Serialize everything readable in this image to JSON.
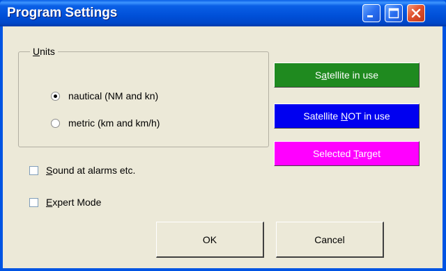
{
  "window": {
    "title": "Program Settings",
    "controls": [
      "minimize-icon",
      "maximize-icon",
      "close-icon"
    ]
  },
  "units_group": {
    "legend_underlined": "U",
    "legend_rest": "nits",
    "options": [
      {
        "label": "nautical (NM and kn)",
        "checked": true
      },
      {
        "label": "metric (km and km/h)",
        "checked": false
      }
    ]
  },
  "checkboxes": [
    {
      "underlined": "S",
      "rest": "ound at alarms etc.",
      "checked": false
    },
    {
      "underlined": "E",
      "rest": "xpert Mode",
      "checked": false
    }
  ],
  "color_buttons": [
    {
      "pre": "S",
      "underlined": "a",
      "post": "tellite in use",
      "color": "#1f8a1f"
    },
    {
      "pre": "Satellite ",
      "underlined": "N",
      "post": "OT in use",
      "color": "#0000f0"
    },
    {
      "pre": "Selected ",
      "underlined": "T",
      "post": "arget",
      "color": "#ff00ff"
    }
  ],
  "buttons": {
    "ok_label": "OK",
    "cancel_label": "Cancel"
  }
}
